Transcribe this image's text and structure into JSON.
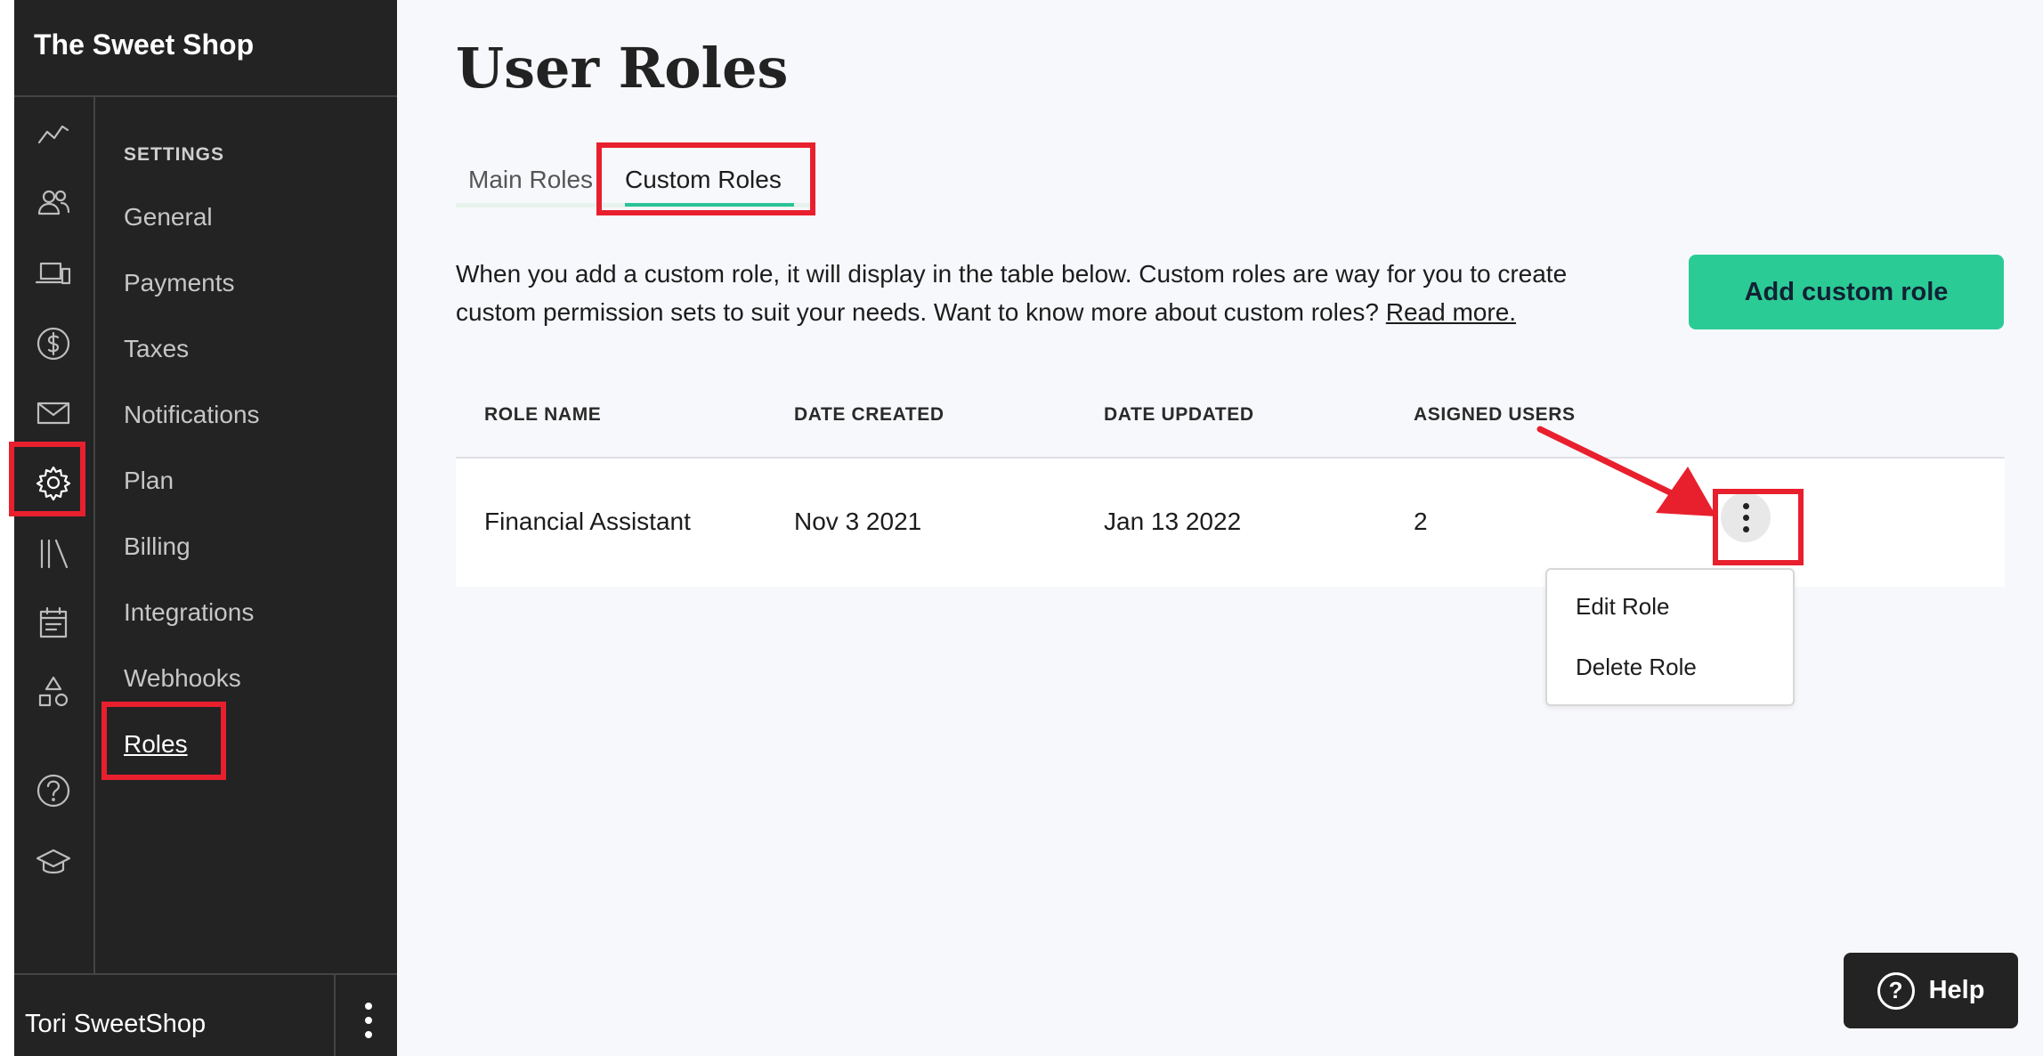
{
  "sidebar": {
    "brand": "The Sweet Shop",
    "rail_icons": [
      "analytics-icon",
      "customers-icon",
      "devices-icon",
      "dollar-icon",
      "mail-icon",
      "gear-icon",
      "library-icon",
      "calendar-icon",
      "shapes-icon",
      "help-circle-icon",
      "graduation-cap-icon"
    ],
    "settings_heading": "SETTINGS",
    "nav_items": [
      "General",
      "Payments",
      "Taxes",
      "Notifications",
      "Plan",
      "Billing",
      "Integrations",
      "Webhooks",
      "Roles"
    ],
    "active_nav": "Roles",
    "user_name": "Tori SweetShop"
  },
  "main": {
    "title": "User Roles",
    "tabs": [
      {
        "label": "Main Roles",
        "active": false
      },
      {
        "label": "Custom Roles",
        "active": true
      }
    ],
    "intro_text": "When you add a custom role, it will display in the table below. Custom roles are way for you to create custom permission sets to suit your needs. Want to know more about custom roles?",
    "intro_link": "Read more.",
    "add_button": "Add custom role",
    "table": {
      "columns": [
        "ROLE NAME",
        "DATE CREATED",
        "DATE UPDATED",
        "ASIGNED USERS"
      ],
      "rows": [
        {
          "role_name": "Financial Assistant",
          "date_created": "Nov 3 2021",
          "date_updated": "Jan 13 2022",
          "assigned_users": "2"
        }
      ]
    },
    "row_menu": [
      "Edit Role",
      "Delete Role"
    ],
    "help_button": "Help"
  },
  "colors": {
    "sidebar_bg": "#232323",
    "accent_green": "#2bcb96",
    "highlight_red": "#e8202e",
    "main_bg": "#f7f8fb"
  }
}
